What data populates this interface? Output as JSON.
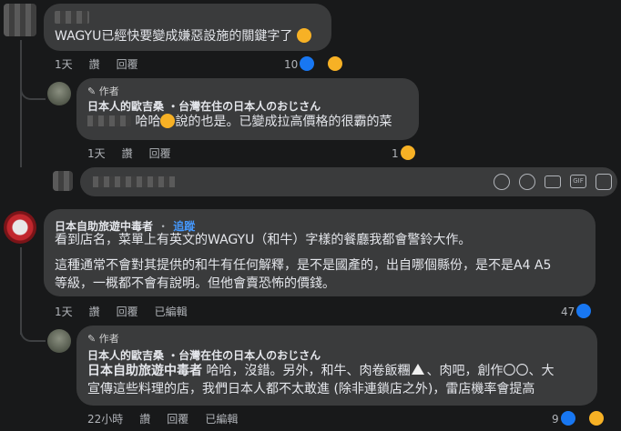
{
  "comment1": {
    "text": "WAGYU已經快要變成嫌惡設施的關鍵字了",
    "meta": [
      "1天",
      "讚",
      "回覆"
    ],
    "reaction_count": "10"
  },
  "reply1": {
    "author_badge": "作者",
    "author": "日本人的歐吉桑 ・台灣在住の日本人のおじさん",
    "text_a": "哈哈",
    "text_b": "說的也是。已變成拉高價格的很霸的菜",
    "meta": [
      "1天",
      "讚",
      "回覆"
    ],
    "reaction_count": "1"
  },
  "composer": {
    "icons": [
      "sticker-icon",
      "emoji-icon",
      "camera-icon",
      "gif-icon",
      "stickers-icon"
    ]
  },
  "comment2": {
    "author": "日本自助旅遊中毒者",
    "follow": "追蹤",
    "para1": "看到店名，菜單上有英文的WAGYU（和牛）字樣的餐廳我都會警鈴大作。",
    "para2_l1": "這種通常不會對其提供的和牛有任何解釋，是不是國產的，出自哪個縣份，是不是A4 A5",
    "para2_l2": "等級，一概都不會有說明。但他會賣恐怖的價錢。",
    "meta": [
      "1天",
      "讚",
      "回覆",
      "已編輯"
    ],
    "reaction_count": "47"
  },
  "reply2": {
    "author_badge": "作者",
    "author": "日本人的歐吉桑 ・台灣在住の日本人のおじさん",
    "mention": "日本自助旅遊中毒者",
    "text_l1": " 哈哈，沒錯。另外，和牛、肉卷飯糰",
    "text_l1b": "、肉吧，創作〇〇、大",
    "text_l2": "宣傳這些料理的店，我們日本人都不太敢進 (除非連鎖店之外)，雷店機率會提高",
    "meta": [
      "22小時",
      "讚",
      "回覆",
      "已編輯"
    ],
    "reaction_count": "9"
  },
  "colors": {
    "background": "#18191a",
    "bubble": "#3a3b3c",
    "like": "#1877f2",
    "haha": "#f7b125"
  }
}
